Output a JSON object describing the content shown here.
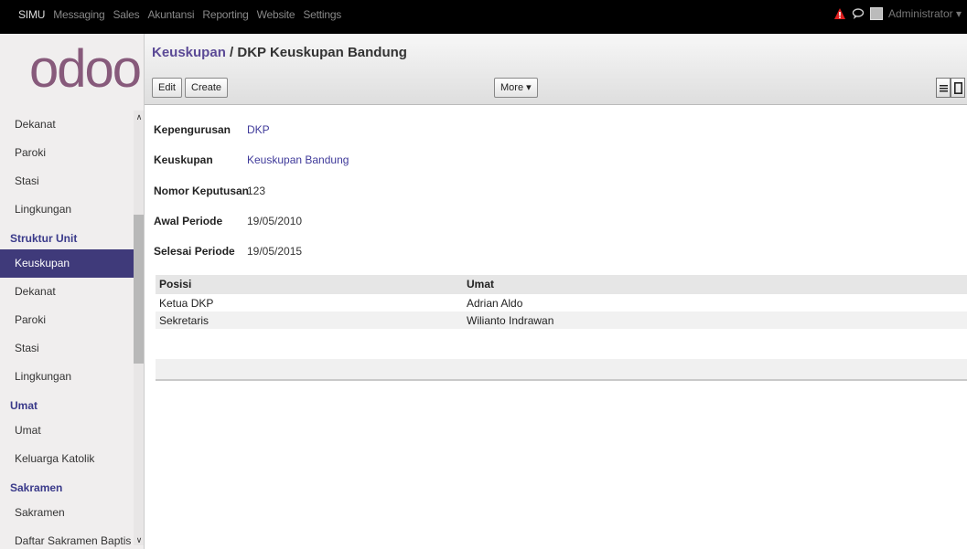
{
  "topbar": {
    "menu": [
      "SIMU",
      "Messaging",
      "Sales",
      "Akuntansi",
      "Reporting",
      "Website",
      "Settings"
    ],
    "active_index": 0,
    "user": "Administrator",
    "alert_color": "#e02020"
  },
  "sidebar": {
    "logo": "odoo",
    "sections": [
      {
        "type": "item",
        "label": "Dekanat"
      },
      {
        "type": "item",
        "label": "Paroki"
      },
      {
        "type": "item",
        "label": "Stasi"
      },
      {
        "type": "item",
        "label": "Lingkungan"
      },
      {
        "type": "header",
        "label": "Struktur Unit"
      },
      {
        "type": "item",
        "label": "Keuskupan",
        "selected": true
      },
      {
        "type": "item",
        "label": "Dekanat"
      },
      {
        "type": "item",
        "label": "Paroki"
      },
      {
        "type": "item",
        "label": "Stasi"
      },
      {
        "type": "item",
        "label": "Lingkungan"
      },
      {
        "type": "header",
        "label": "Umat"
      },
      {
        "type": "item",
        "label": "Umat"
      },
      {
        "type": "item",
        "label": "Keluarga Katolik"
      },
      {
        "type": "header",
        "label": "Sakramen"
      },
      {
        "type": "item",
        "label": "Sakramen"
      },
      {
        "type": "item",
        "label": "Daftar Sakramen Baptis"
      }
    ]
  },
  "control": {
    "breadcrumb_parent": "Keuskupan",
    "breadcrumb_sep": " / ",
    "breadcrumb_current": "DKP Keuskupan Bandung",
    "edit_label": "Edit",
    "create_label": "Create",
    "more_label": "More"
  },
  "form": {
    "fields": [
      {
        "label": "Kepengurusan",
        "value": "DKP",
        "link": true
      },
      {
        "label": "Keuskupan",
        "value": "Keuskupan Bandung",
        "link": true
      },
      {
        "label": "Nomor Keputusan",
        "value": "123",
        "link": false
      },
      {
        "label": "Awal Periode",
        "value": "19/05/2010",
        "link": false
      },
      {
        "label": "Selesai Periode",
        "value": "19/05/2015",
        "link": false
      }
    ],
    "table": {
      "headers": [
        "Posisi",
        "Umat"
      ],
      "rows": [
        [
          "Ketua DKP",
          "Adrian Aldo"
        ],
        [
          "Sekretaris",
          "Wilianto Indrawan"
        ]
      ]
    }
  }
}
